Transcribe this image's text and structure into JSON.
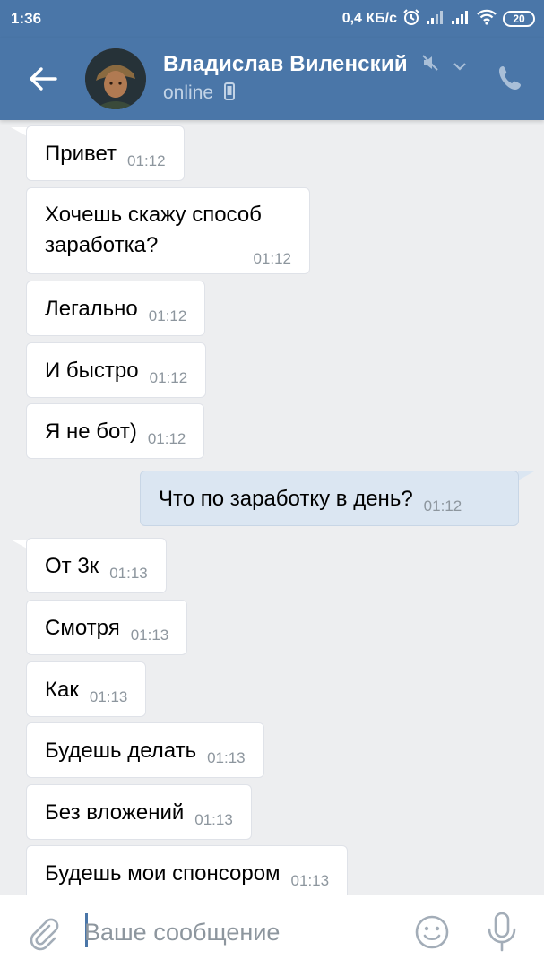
{
  "status_bar": {
    "time": "1:36",
    "speed": "0,4 КБ/с",
    "battery": "20"
  },
  "header": {
    "contact_name": "Владислав Виленский",
    "status": "online",
    "colors": {
      "bar": "#4a76a8"
    }
  },
  "messages": [
    {
      "direction": "in",
      "text": "Привет",
      "time": "01:12"
    },
    {
      "direction": "in",
      "text_lines": [
        "Хочешь скажу способ",
        "заработка?"
      ],
      "time": "01:12"
    },
    {
      "direction": "in",
      "text": "Легально",
      "time": "01:12"
    },
    {
      "direction": "in",
      "text": "И быстро",
      "time": "01:12"
    },
    {
      "direction": "in",
      "text": "Я не бот)",
      "time": "01:12"
    },
    {
      "direction": "out",
      "text": "Что по заработку в день?",
      "time": "01:12"
    },
    {
      "direction": "in",
      "text": "От 3к",
      "time": "01:13"
    },
    {
      "direction": "in",
      "text": "Смотря",
      "time": "01:13"
    },
    {
      "direction": "in",
      "text": "Как",
      "time": "01:13"
    },
    {
      "direction": "in",
      "text": "Будешь делать",
      "time": "01:13"
    },
    {
      "direction": "in",
      "text": "Без вложений",
      "time": "01:13"
    },
    {
      "direction": "in",
      "text": "Будешь мои спонсором",
      "time": "01:13"
    }
  ],
  "composer": {
    "placeholder": "Ваше сообщение",
    "value": ""
  },
  "icons": {
    "back": "arrow-left-icon",
    "mute": "muted-speaker-icon",
    "chevron": "chevron-down-icon",
    "phone": "phone-icon",
    "device": "mobile-device-icon",
    "attach": "paperclip-icon",
    "emoji": "smiley-icon",
    "mic": "microphone-icon"
  }
}
